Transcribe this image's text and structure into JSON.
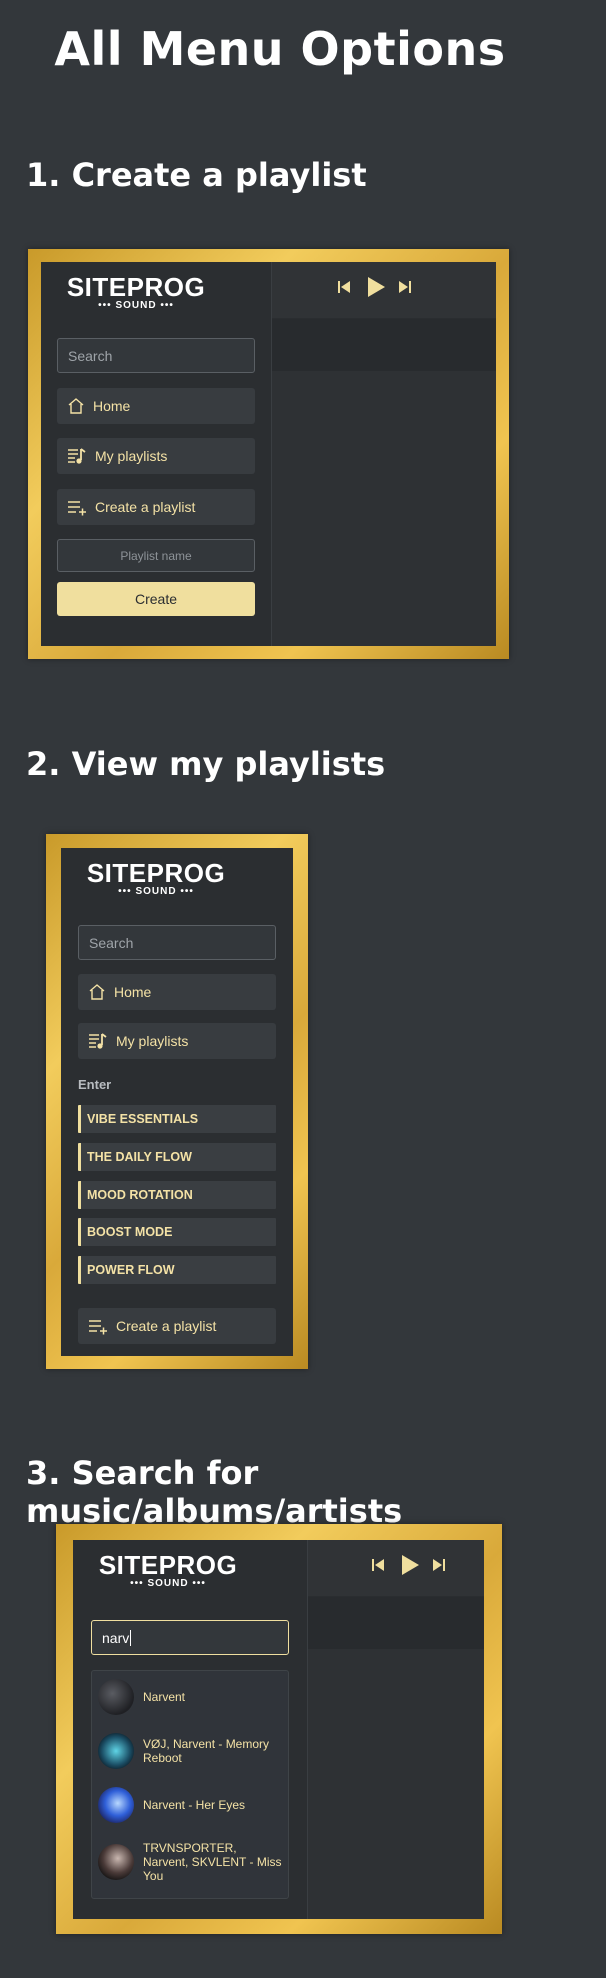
{
  "page": {
    "title": "All Menu Options"
  },
  "sections": [
    {
      "title": "1. Create a playlist"
    },
    {
      "title": "2. View my playlists"
    },
    {
      "title": "3. Search for music/albums/artists"
    }
  ],
  "logo": {
    "main": "SITEPROG",
    "sub": "••• SOUND •••"
  },
  "sidebar": {
    "search_placeholder": "Search",
    "home_label": "Home",
    "my_playlists_label": "My playlists",
    "create_playlist_label": "Create a playlist"
  },
  "create_form": {
    "name_placeholder": "Playlist name",
    "create_label": "Create"
  },
  "playlists": {
    "enter_label": "Enter",
    "items": [
      "VIBE ESSENTIALS",
      "THE DAILY FLOW",
      "MOOD ROTATION",
      "BOOST MODE",
      "POWER FLOW"
    ]
  },
  "search_demo": {
    "query": "narv",
    "results": [
      {
        "text": "Narvent"
      },
      {
        "text": "VØJ, Narvent - Memory Reboot"
      },
      {
        "text": "Narvent - Her Eyes"
      },
      {
        "text": "TRVNSPORTER, Narvent, SKVLENT - Miss You"
      }
    ]
  },
  "colors": {
    "accent": "#f0df9e",
    "gold": "#e0b040",
    "background": "#33373b",
    "panel": "#2b2e31"
  }
}
